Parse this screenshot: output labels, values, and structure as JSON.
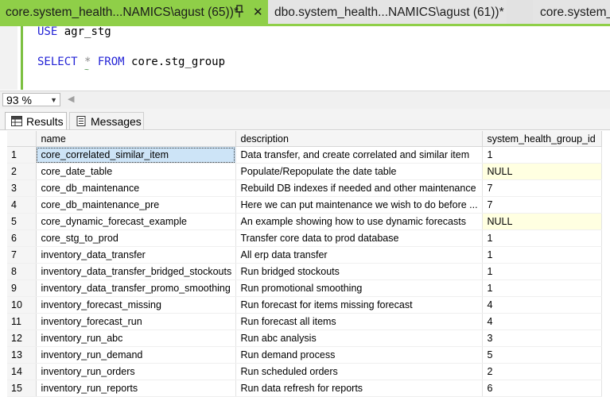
{
  "tabs": [
    {
      "label": "core.system_health...NAMICS\\agust (65))*",
      "active": true
    },
    {
      "label": "dbo.system_health...NAMICS\\agust (61))*",
      "active": false
    },
    {
      "label": "core.system_h",
      "active": false
    }
  ],
  "tab_close_glyph": "✕",
  "editor": {
    "line1_kw": "USE",
    "line1_rest": " agr_stg",
    "line2_kw1": "SELECT",
    "line2_star": " * ",
    "line2_kw2": "FROM",
    "line2_rest": " core.stg_group",
    "squiggle": "~"
  },
  "zoom": {
    "value": "93 %"
  },
  "result_tabs": {
    "results": "Results",
    "messages": "Messages"
  },
  "grid": {
    "columns": [
      "",
      "name",
      "description",
      "system_health_group_id"
    ],
    "rows": [
      {
        "n": "1",
        "name": "core_correlated_similar_item",
        "description": "Data transfer, and create correlated and similar item",
        "id": "1"
      },
      {
        "n": "2",
        "name": "core_date_table",
        "description": "Populate/Repopulate the date table",
        "id": "NULL"
      },
      {
        "n": "3",
        "name": "core_db_maintenance",
        "description": "Rebuild DB indexes if needed and other maintenance",
        "id": "7"
      },
      {
        "n": "4",
        "name": "core_db_maintenance_pre",
        "description": "Here we can put maintenance we wish to do before ...",
        "id": "7"
      },
      {
        "n": "5",
        "name": "core_dynamic_forecast_example",
        "description": "An example showing how to use dynamic forecasts",
        "id": "NULL"
      },
      {
        "n": "6",
        "name": "core_stg_to_prod",
        "description": "Transfer core data to prod database",
        "id": "1"
      },
      {
        "n": "7",
        "name": "inventory_data_transfer",
        "description": "All erp data transfer",
        "id": "1"
      },
      {
        "n": "8",
        "name": "inventory_data_transfer_bridged_stockouts",
        "description": "Run bridged stockouts",
        "id": "1"
      },
      {
        "n": "9",
        "name": "inventory_data_transfer_promo_smoothing",
        "description": "Run promotional smoothing",
        "id": "1"
      },
      {
        "n": "10",
        "name": "inventory_forecast_missing",
        "description": "Run forecast for items missing forecast",
        "id": "4"
      },
      {
        "n": "11",
        "name": "inventory_forecast_run",
        "description": "Run forecast all items",
        "id": "4"
      },
      {
        "n": "12",
        "name": "inventory_run_abc",
        "description": "Run abc analysis",
        "id": "3"
      },
      {
        "n": "13",
        "name": "inventory_run_demand",
        "description": "Run demand process",
        "id": "5"
      },
      {
        "n": "14",
        "name": "inventory_run_orders",
        "description": "Run scheduled orders",
        "id": "2"
      },
      {
        "n": "15",
        "name": "inventory_run_reports",
        "description": "Run data refresh for reports",
        "id": "6"
      }
    ]
  },
  "colors": {
    "active_tab": "#8fcf48",
    "keyword": "#2323d6",
    "null_cell": "#ffffe1",
    "selected_cell": "#cde4f7"
  }
}
